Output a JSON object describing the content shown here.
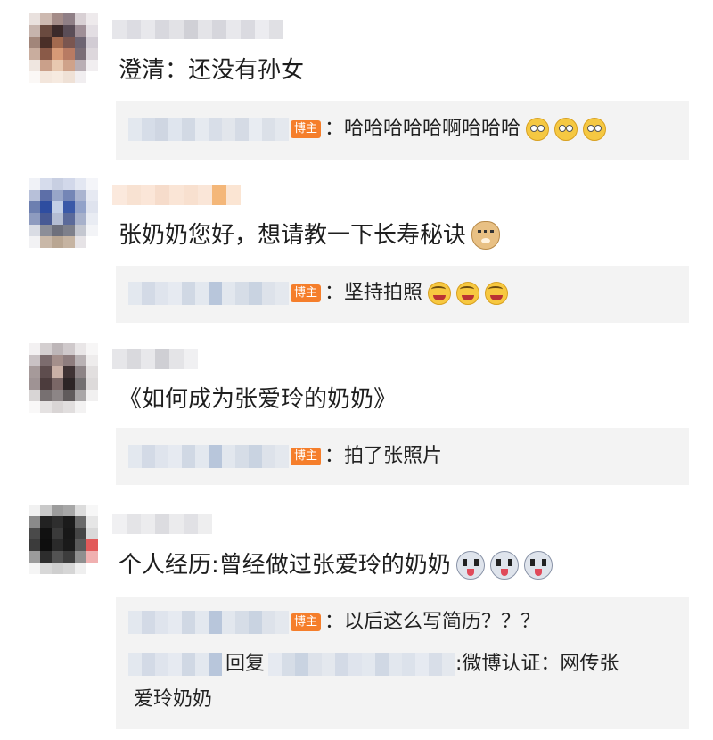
{
  "colors": {
    "badge_bg": "#f57e2b",
    "reply_bg": "#f3f3f3"
  },
  "badge_label": "博主",
  "comments": [
    {
      "text": "澄清：还没有孙女",
      "emojis": [],
      "replies": [
        {
          "badge": true,
          "text": "：哈哈哈哈哈啊哈哈哈",
          "emojis": [
            "eye-roll-emoji",
            "eye-roll-emoji",
            "eye-roll-emoji"
          ]
        }
      ]
    },
    {
      "text": "张奶奶您好，想请教一下长寿秘诀",
      "emojis": [
        "doge-emoji"
      ],
      "replies": [
        {
          "badge": true,
          "text": "：坚持拍照",
          "emojis": [
            "laugh-cry-emoji",
            "laugh-cry-emoji",
            "laugh-cry-emoji"
          ]
        }
      ]
    },
    {
      "text": "《如何成为张爱玲的奶奶》",
      "emojis": [],
      "replies": [
        {
          "badge": true,
          "text": "：拍了张照片",
          "emojis": []
        }
      ]
    },
    {
      "text": "个人经历:曾经做过张爱玲的奶奶",
      "emojis": [
        "husky-emoji",
        "husky-emoji",
        "husky-emoji"
      ],
      "replies": [
        {
          "badge": true,
          "text": "：以后这么写简历？？？",
          "emojis": []
        },
        {
          "badge": false,
          "reply_word": "回复",
          "text": ":微博认证：网传张",
          "text2": "爱玲奶奶",
          "emojis": []
        }
      ]
    }
  ]
}
